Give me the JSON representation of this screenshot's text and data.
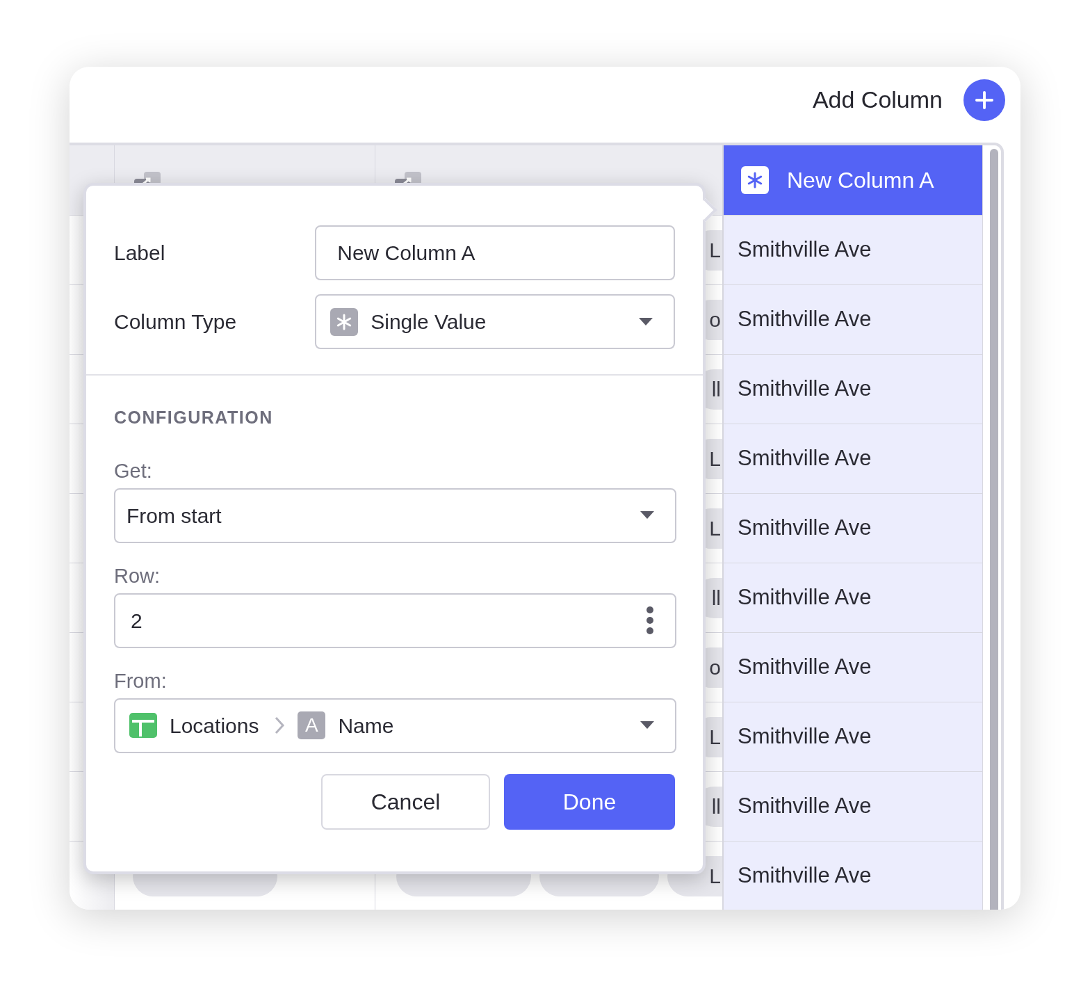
{
  "header": {
    "title": "Add Column"
  },
  "table": {
    "new_column": {
      "label": "New Column A",
      "selected": true
    },
    "rows": [
      {
        "column_2": [
          "L"
        ],
        "value": "Smithville Ave"
      },
      {
        "column_2": [
          "o"
        ],
        "value": "Smithville Ave"
      },
      {
        "column_2": [
          "ll"
        ],
        "value": "Smithville Ave"
      },
      {
        "column_2": [
          "L"
        ],
        "value": "Smithville Ave"
      },
      {
        "column_2": [
          "L"
        ],
        "value": "Smithville Ave"
      },
      {
        "column_2": [
          "ll"
        ],
        "value": "Smithville Ave"
      },
      {
        "column_2": [
          "o"
        ],
        "value": "Smithville Ave"
      },
      {
        "column_2": [
          "L"
        ],
        "value": "Smithville Ave"
      },
      {
        "column_2": [
          "ll"
        ],
        "value": "Smithville Ave"
      },
      {
        "column_2": [
          "L"
        ],
        "value": "Smithville Ave"
      }
    ]
  },
  "dialog": {
    "fields": [
      {
        "label": "Label",
        "kind": "text",
        "value": "New Column A"
      },
      {
        "label": "Column Type",
        "kind": "type-select",
        "value": "Single Value"
      }
    ],
    "section_title": "CONFIGURATION",
    "config": [
      {
        "label": "Get:",
        "kind": "select",
        "value": "From start"
      },
      {
        "label": "Row:",
        "kind": "number",
        "value": "2"
      },
      {
        "label": "From:",
        "kind": "path",
        "path": [
          {
            "kind": "table",
            "text": "Locations"
          },
          {
            "kind": "text-field",
            "icon_text": "A",
            "text": "Name"
          }
        ]
      }
    ],
    "buttons": [
      {
        "label": "Cancel",
        "kind": "secondary"
      },
      {
        "label": "Done",
        "kind": "primary"
      }
    ]
  }
}
